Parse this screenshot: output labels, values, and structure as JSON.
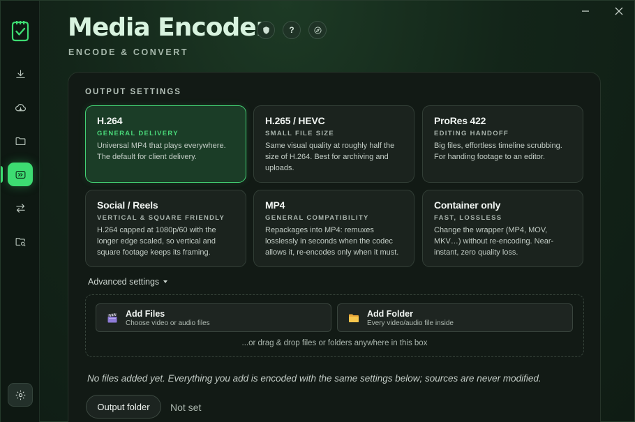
{
  "app": {
    "title": "Media Encoder",
    "subtitle": "ENCODE & CONVERT",
    "header_icons": [
      "shield-icon",
      "help-icon",
      "compass-icon"
    ],
    "help_glyph": "?"
  },
  "sidebar": {
    "items": [
      {
        "name": "download",
        "icon": "download-icon"
      },
      {
        "name": "cloud",
        "icon": "cloud-icon"
      },
      {
        "name": "folder",
        "icon": "folder-icon"
      },
      {
        "name": "encode",
        "icon": "encode-icon",
        "active": true
      },
      {
        "name": "convert",
        "icon": "swap-arrows-icon"
      },
      {
        "name": "search-files",
        "icon": "folder-search-icon"
      }
    ],
    "settings_icon": "gear-icon"
  },
  "output_settings": {
    "label": "OUTPUT SETTINGS",
    "cards": [
      {
        "title": "H.264",
        "tag": "GENERAL DELIVERY",
        "desc": "Universal MP4 that plays everywhere. The default for client delivery.",
        "selected": true
      },
      {
        "title": "H.265 / HEVC",
        "tag": "SMALL FILE SIZE",
        "desc": "Same visual quality at roughly half the size of H.264. Best for archiving and uploads."
      },
      {
        "title": "ProRes 422",
        "tag": "EDITING HANDOFF",
        "desc": "Big files, effortless timeline scrubbing. For handing footage to an editor."
      },
      {
        "title": "Social / Reels",
        "tag": "VERTICAL & SQUARE FRIENDLY",
        "desc": "H.264 capped at 1080p/60 with the longer edge scaled, so vertical and square footage keeps its framing."
      },
      {
        "title": "MP4",
        "tag": "GENERAL COMPATIBILITY",
        "desc": "Repackages into MP4: remuxes losslessly in seconds when the codec allows it, re-encodes only when it must."
      },
      {
        "title": "Container only",
        "tag": "FAST, LOSSLESS",
        "desc": "Change the wrapper (MP4, MOV, MKV…) without re-encoding. Near-instant, zero quality loss."
      }
    ],
    "advanced_label": "Advanced settings"
  },
  "dropzone": {
    "add_files": {
      "title": "Add Files",
      "sub": "Choose video or audio files",
      "icon": "clapperboard-icon"
    },
    "add_folder": {
      "title": "Add Folder",
      "sub": "Every video/audio file inside",
      "icon": "folder-icon"
    },
    "hint": "...or drag & drop files or folders anywhere in this box"
  },
  "status": {
    "empty_message": "No files added yet. Everything you add is encoded with the same settings below; sources are never modified."
  },
  "output_folder": {
    "button_label": "Output folder",
    "value": "Not set"
  },
  "colors": {
    "accent": "#3ddc72",
    "background": "#0f1c14",
    "panel": "#121a15"
  }
}
